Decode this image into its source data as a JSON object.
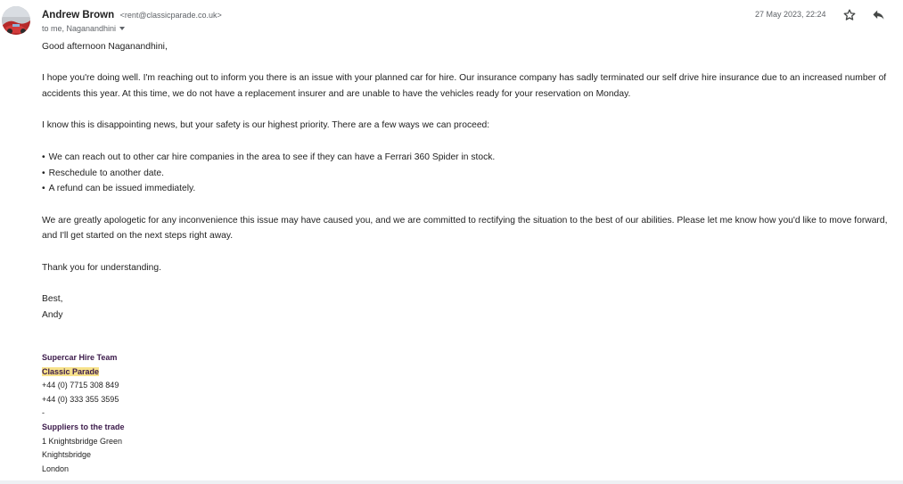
{
  "header": {
    "sender_name": "Andrew Brown",
    "sender_email": "<rent@classicparade.co.uk>",
    "recipients": "to me, Naganandhini",
    "timestamp": "27 May 2023, 22:24",
    "icons": {
      "star": "star-icon",
      "reply": "reply-icon",
      "caret": "chevron-down-icon"
    }
  },
  "body": {
    "greeting": "Good afternoon Naganandhini,",
    "para1": "I hope you're doing well. I'm reaching out to inform you there is an issue with your planned car for hire. Our insurance company has sadly terminated our self drive hire insurance due to an increased number of accidents this year. At this time, we do not have a replacement insurer and are unable to have the vehicles ready for your reservation on Monday.",
    "para2": "I know this is disappointing news, but your safety is our highest priority. There are a few ways we can proceed:",
    "options": [
      "We can reach out to other car hire companies in the area to see if they can have a Ferrari 360 Spider in stock.",
      "Reschedule to another date.",
      "A refund can be issued immediately."
    ],
    "para3": "We are greatly apologetic for any inconvenience this issue may have caused you, and we are committed to rectifying the situation to the best of our abilities. Please let me know how you'd like to move forward, and I'll get started on the next steps right away.",
    "thanks": "Thank you for understanding.",
    "signoff": "Best,",
    "signer": "Andy"
  },
  "signature": {
    "team": "Supercar Hire Team",
    "company": "Classic Parade",
    "phone1": "+44 (0) 7715 308 849",
    "phone2": "+44 (0) 333 355 3595",
    "separator": "-",
    "tagline": "Suppliers to the trade",
    "address1": "1 Knightsbridge Green",
    "address2": "Knightsbridge",
    "address3": "London"
  },
  "colors": {
    "signature_text": "#3b1a4a",
    "highlight": "#f7e28b",
    "meta_text": "#5f6368"
  }
}
